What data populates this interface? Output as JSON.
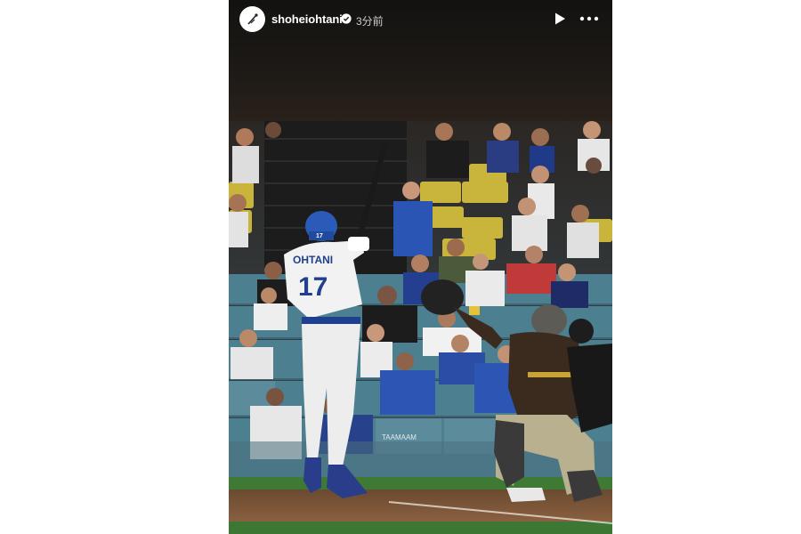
{
  "story": {
    "username": "shoheiohtani",
    "time_ago": "3分前",
    "verified_icon": "verified-badge-icon",
    "play_icon": "play-icon",
    "more_icon": "more-options-icon"
  },
  "photo": {
    "batter_name": "OHTANI",
    "batter_number": "17",
    "helmet_number": "17",
    "sign_text": "TAAMAAM",
    "colors": {
      "dodgers_blue": "#2a5bb8",
      "padres_brown": "#3b2a1e",
      "seat_yellow": "#c9b43c",
      "seat_teal": "#4c7f90",
      "infield_dirt": "#7a5436",
      "grass": "#3e7a34"
    }
  }
}
